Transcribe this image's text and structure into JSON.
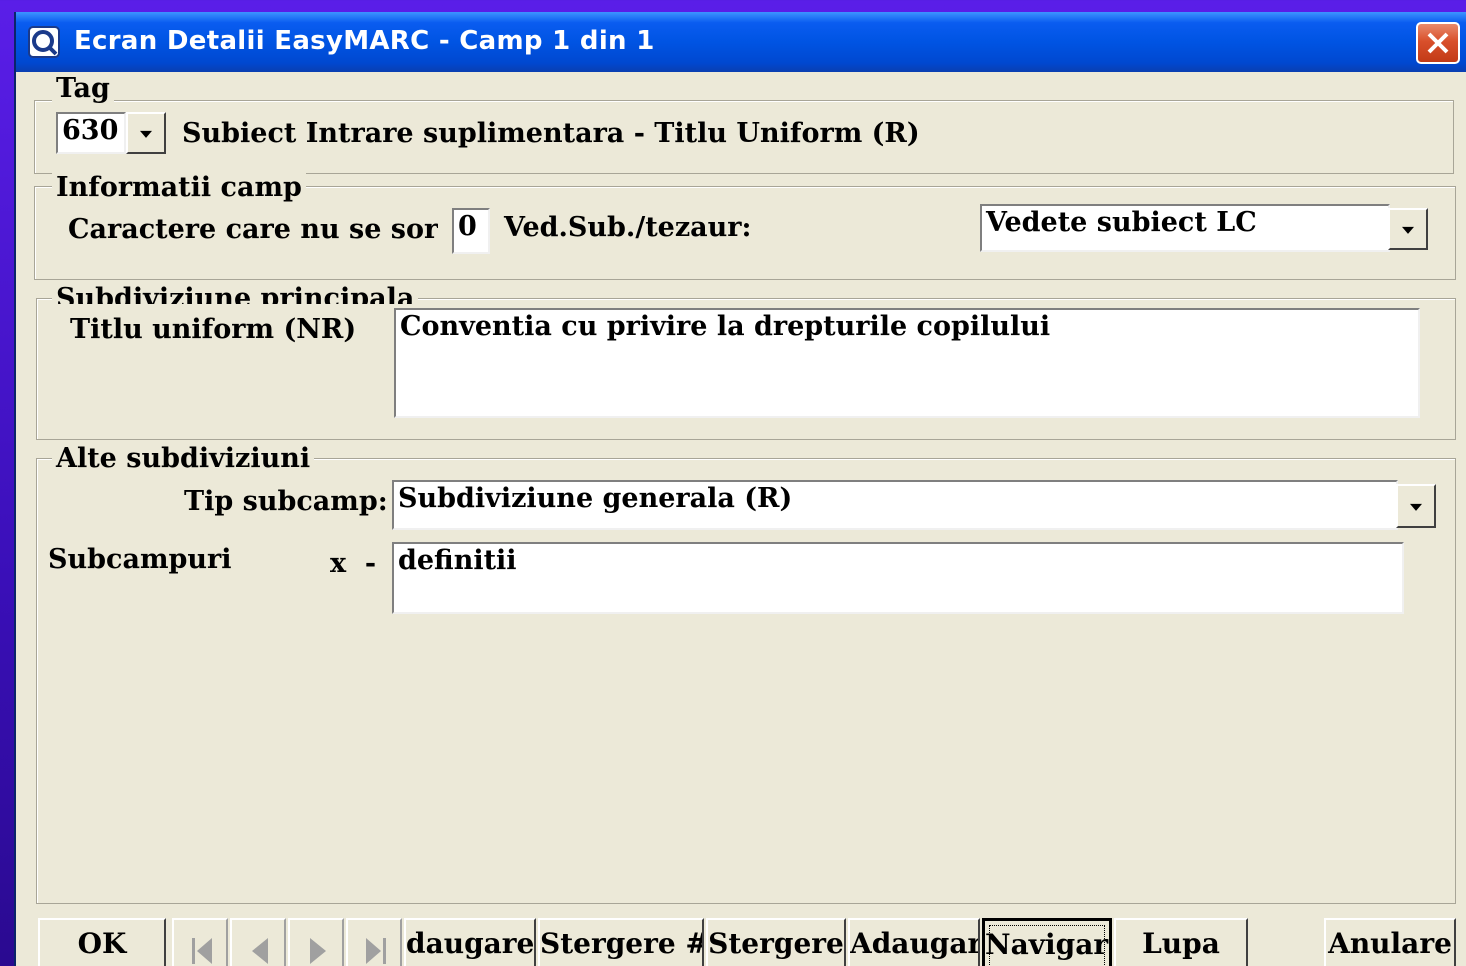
{
  "window": {
    "title": "Ecran Detalii EasyMARC - Camp 1 din 1",
    "icon": "app-search-icon"
  },
  "tag_group": {
    "legend": "Tag",
    "tag_value": "630",
    "tag_description": "Subiect Intrare suplimentara - Titlu Uniform (R)"
  },
  "field_info": {
    "legend": "Informatii camp",
    "nonsort_label": "Caractere care nu se sort",
    "nonsort_value": "0",
    "thesaurus_label": "Ved.Sub./tezaur:",
    "thesaurus_value": "Vedete subiect LC"
  },
  "main_subdivision": {
    "legend": "Subdiviziune principala",
    "label": "Titlu uniform (NR)",
    "value": "Conventia cu privire la drepturile copilului"
  },
  "other_subdivisions": {
    "legend": "Alte subdiviziuni",
    "type_label": "Tip subcamp:",
    "type_value": "Subdiviziune generala (R)",
    "subfields_label": "Subcampuri",
    "subfield_code": "x  -",
    "subfield_value": "definitii"
  },
  "buttons": {
    "ok": "OK",
    "add_partial": "daugare",
    "delete_hash": "Stergere #",
    "delete": "Stergere",
    "add2": "Adaugare",
    "navigate": "Navigare",
    "lupa": "Lupa",
    "cancel": "Anulare"
  },
  "colors": {
    "title_bar": "#0054e3",
    "window_bg": "#ece9d8",
    "desktop": "#4a14d0",
    "close": "#d9502b"
  }
}
